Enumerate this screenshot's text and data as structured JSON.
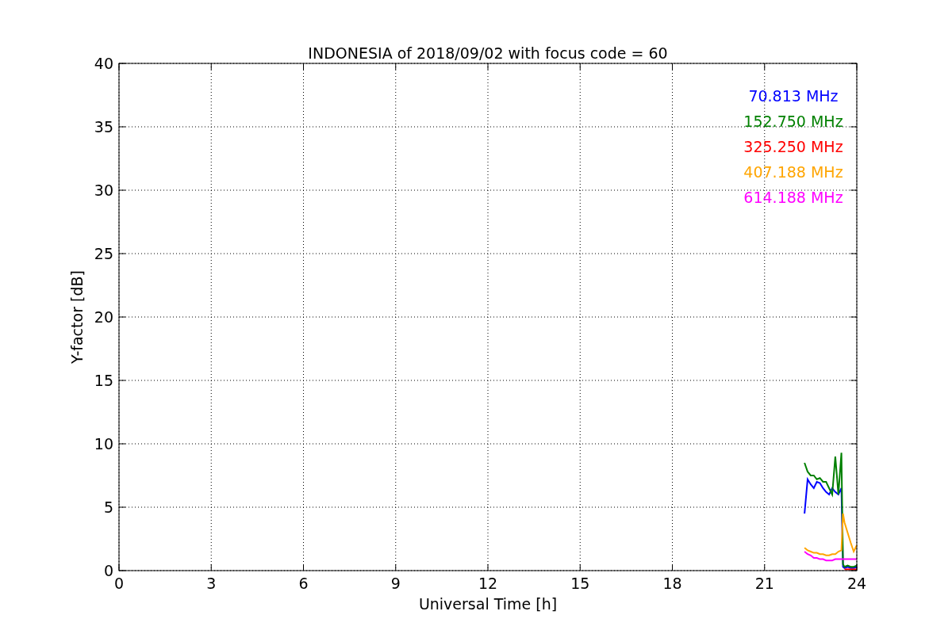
{
  "chart_data": {
    "type": "line",
    "title": "INDONESIA of 2018/09/02 with focus code = 60",
    "xlabel": "Universal Time [h]",
    "ylabel": "Y-factor [dB]",
    "x": [
      22.3,
      22.4,
      22.5,
      22.6,
      22.7,
      22.8,
      22.9,
      23.0,
      23.1,
      23.2,
      23.3,
      23.4,
      23.5,
      23.55,
      23.6,
      23.7,
      23.8,
      23.9,
      24.0
    ],
    "series": [
      {
        "name": "70.813 MHz",
        "color": "#0000ff",
        "values": [
          4.5,
          7.2,
          6.8,
          6.5,
          7.0,
          6.9,
          6.5,
          6.2,
          6.0,
          6.5,
          6.2,
          6.0,
          6.5,
          0.3,
          0.2,
          0.3,
          0.2,
          0.2,
          0.3
        ]
      },
      {
        "name": "152.750 MHz",
        "color": "#008000",
        "values": [
          8.5,
          7.8,
          7.5,
          7.5,
          7.2,
          7.3,
          7.0,
          7.0,
          6.5,
          6.0,
          9.0,
          6.0,
          9.3,
          0.5,
          0.3,
          0.4,
          0.3,
          0.3,
          0.4
        ]
      },
      {
        "name": "325.250 MHz",
        "color": "#ff0000",
        "values": [
          null,
          null,
          null,
          null,
          null,
          null,
          null,
          null,
          null,
          null,
          null,
          null,
          null,
          null,
          0.1,
          0.1,
          0.1,
          0.1,
          0.1
        ]
      },
      {
        "name": "407.188 MHz",
        "color": "#ffa500",
        "values": [
          1.8,
          1.6,
          1.5,
          1.4,
          1.4,
          1.3,
          1.3,
          1.2,
          1.2,
          1.3,
          1.3,
          1.5,
          1.6,
          4.5,
          3.8,
          3.0,
          2.2,
          1.5,
          2.0
        ]
      },
      {
        "name": "614.188 MHz",
        "color": "#ff00ff",
        "values": [
          1.5,
          1.3,
          1.2,
          1.0,
          1.0,
          0.9,
          0.9,
          0.8,
          0.8,
          0.8,
          0.9,
          0.9,
          0.9,
          0.9,
          0.9,
          0.9,
          0.9,
          0.9,
          0.9
        ]
      }
    ],
    "xlim": [
      0,
      24
    ],
    "ylim": [
      0,
      40
    ],
    "xticks": [
      0,
      3,
      6,
      9,
      12,
      15,
      18,
      21,
      24
    ],
    "yticks": [
      0,
      5,
      10,
      15,
      20,
      25,
      30,
      35,
      40
    ],
    "grid": true
  }
}
